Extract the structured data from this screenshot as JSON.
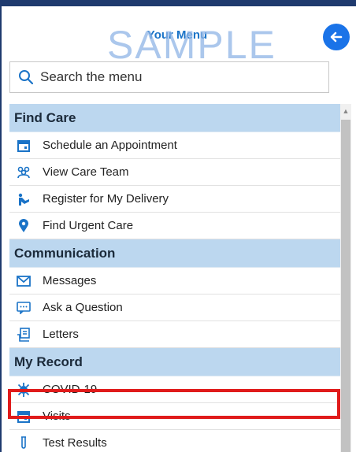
{
  "header": {
    "title": "Your Menu"
  },
  "search": {
    "placeholder": "Search the menu"
  },
  "watermark": "SAMPLE",
  "sections": [
    {
      "label": "Find Care",
      "items": [
        {
          "label": "Schedule an Appointment",
          "icon": "calendar-icon"
        },
        {
          "label": "View Care Team",
          "icon": "care-team-icon"
        },
        {
          "label": "Register for My Delivery",
          "icon": "delivery-icon"
        },
        {
          "label": "Find Urgent Care",
          "icon": "location-pin-icon"
        }
      ]
    },
    {
      "label": "Communication",
      "items": [
        {
          "label": "Messages",
          "icon": "envelope-icon"
        },
        {
          "label": "Ask a Question",
          "icon": "chat-bubble-icon"
        },
        {
          "label": "Letters",
          "icon": "letter-icon"
        }
      ]
    },
    {
      "label": "My Record",
      "items": [
        {
          "label": "COVID-19",
          "icon": "virus-icon"
        },
        {
          "label": "Visits",
          "icon": "calendar-icon"
        },
        {
          "label": "Test Results",
          "icon": "test-tube-icon"
        }
      ]
    }
  ],
  "colors": {
    "accent": "#1a73e8",
    "section_bg": "#bcd7ef",
    "highlight": "#e01b1b",
    "frame": "#1f3a6e"
  }
}
